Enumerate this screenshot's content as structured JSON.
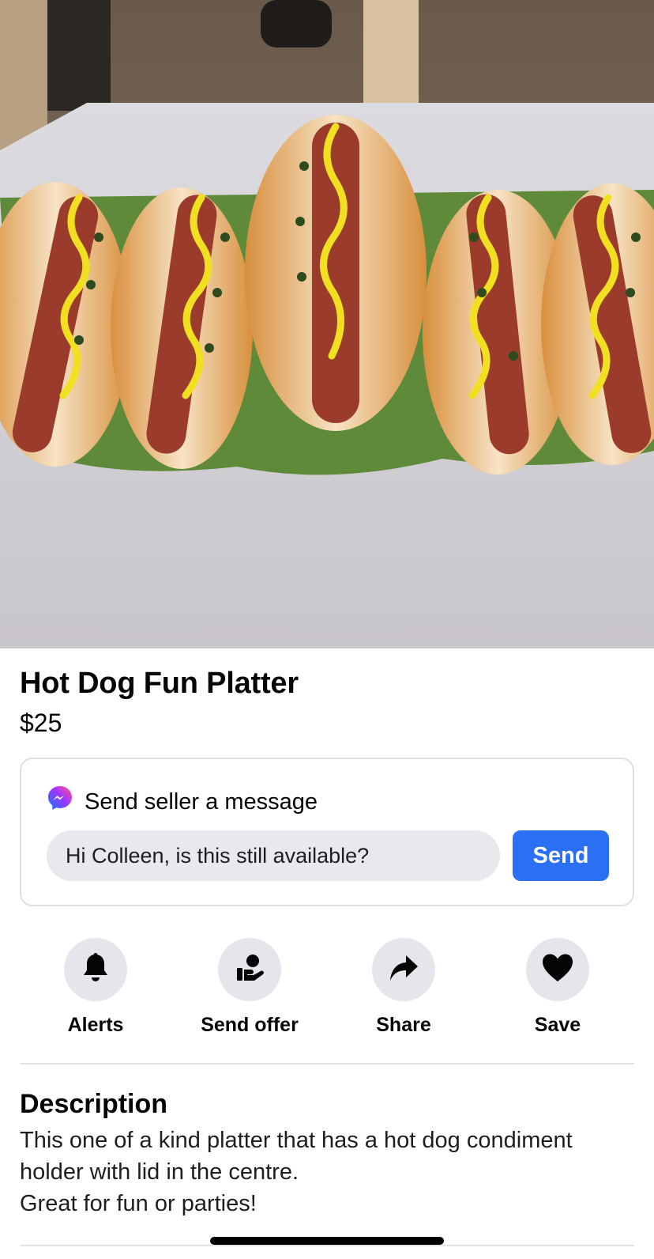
{
  "listing": {
    "title": "Hot Dog Fun Platter",
    "price": "$25"
  },
  "message": {
    "label": "Send seller a message",
    "input_value": "Hi Colleen, is this still available?",
    "send_label": "Send",
    "icon": "messenger-icon",
    "accent": "#2b6ff2"
  },
  "actions": [
    {
      "label": "Alerts",
      "icon": "bell-icon"
    },
    {
      "label": "Send offer",
      "icon": "offer-hand-icon"
    },
    {
      "label": "Share",
      "icon": "share-arrow-icon"
    },
    {
      "label": "Save",
      "icon": "heart-icon"
    }
  ],
  "description": {
    "heading": "Description",
    "lines": [
      "This one of a kind platter that has a hot dog condiment",
      "holder with lid in the centre.",
      "Great for fun or parties!"
    ]
  }
}
